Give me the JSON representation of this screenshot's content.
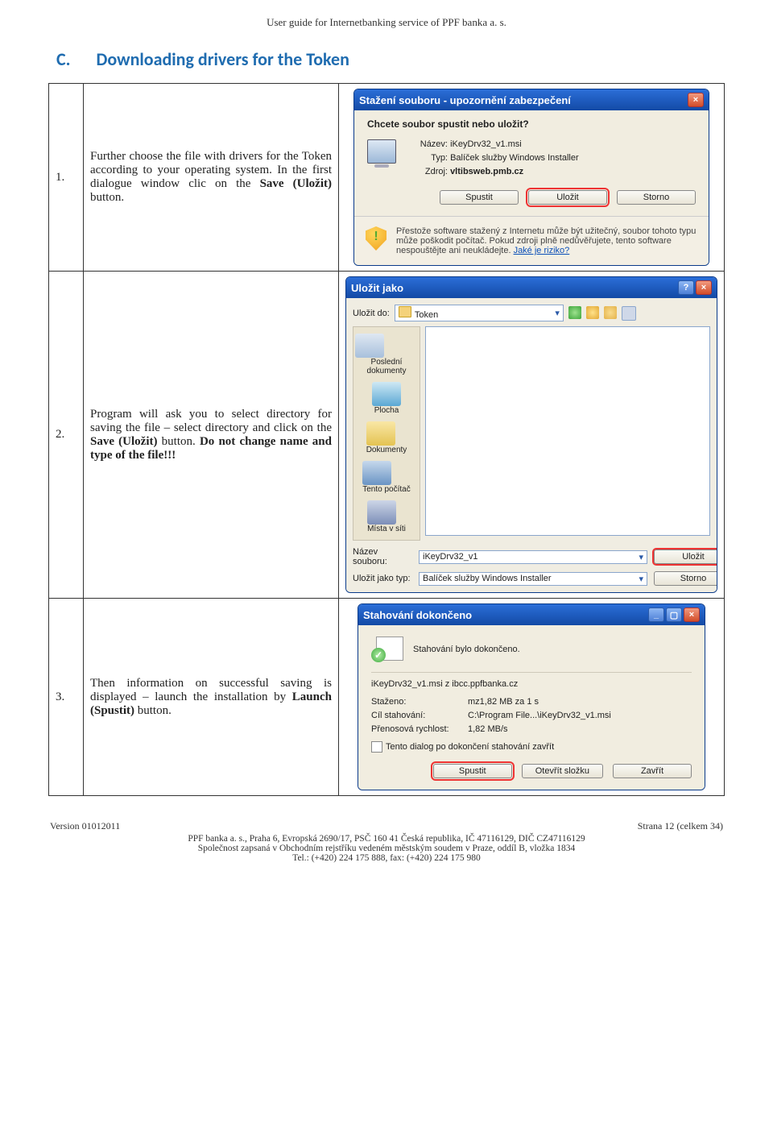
{
  "header": "User guide for Internetbanking service of PPF banka a. s.",
  "section": {
    "letter": "C.",
    "title": "Downloading drivers for the Token"
  },
  "rows": [
    {
      "num": "1.",
      "p1": "Further choose the file with drivers for the Token according to your operating system. In the first dialogue window clic on the ",
      "b1": "Save (Uložit)",
      "p2": " button."
    },
    {
      "num": "2.",
      "p1": "Program will ask you to select directory for saving the file – select directory and click on the ",
      "b1": "Save (Uložit)",
      "p2": " button.",
      "b2": " Do not change name and type of the file!!!"
    },
    {
      "num": "3.",
      "p1": "Then information on successful saving is displayed – launch the installation by ",
      "b1": "Launch (Spustit)",
      "p2": " button."
    }
  ],
  "dialog1": {
    "title": "Stažení souboru - upozornění zabezpečení",
    "subtitle": "Chcete soubor spustit nebo uložit?",
    "labels": {
      "name": "Název:",
      "type": "Typ:",
      "source": "Zdroj:"
    },
    "name": "iKeyDrv32_v1.msi",
    "type": "Balíček služby Windows Installer",
    "source": "vltibsweb.pmb.cz",
    "btnRun": "Spustit",
    "btnSave": "Uložit",
    "btnCancel": "Storno",
    "warning": "Přestože software stažený z Internetu může být užitečný, soubor tohoto typu může poškodit počítač. Pokud zdroji plně nedůvěřujete, tento software nespouštějte ani neukládejte. ",
    "warnLink": "Jaké je riziko?"
  },
  "dialog2": {
    "title": "Uložit jako",
    "saveIn": "Uložit do:",
    "folder": "Token",
    "places": {
      "recent": "Poslední dokumenty",
      "desktop": "Plocha",
      "docs": "Dokumenty",
      "pc": "Tento počítač",
      "net": "Místa v síti"
    },
    "labels": {
      "filename": "Název souboru:",
      "filetype": "Uložit jako typ:"
    },
    "filename": "iKeyDrv32_v1",
    "filetype": "Balíček služby Windows Installer",
    "btnSave": "Uložit",
    "btnCancel": "Storno"
  },
  "dialog3": {
    "title": "Stahování dokončeno",
    "done": "Stahování bylo dokončeno.",
    "file": "iKeyDrv32_v1.msi z ibcc.ppfbanka.cz",
    "labels": {
      "downloaded": "Staženo:",
      "target": "Cíl stahování:",
      "rate": "Přenosová rychlost:"
    },
    "downloaded": "mz1,82 MB za 1 s",
    "target": "C:\\Program File...\\iKeyDrv32_v1.msi",
    "rate": "1,82 MB/s",
    "checkbox": "Tento dialog po dokončení stahování zavřít",
    "btnRun": "Spustit",
    "btnOpen": "Otevřít složku",
    "btnClose": "Zavřít"
  },
  "footer": {
    "version": "Version 01012011",
    "page": "Strana 12 (celkem 34)",
    "line1": "PPF banka a. s., Praha 6, Evropská 2690/17, PSČ 160 41 Česká republika, IČ 47116129, DIČ CZ47116129",
    "line2": "Společnost zapsaná v Obchodním rejstříku vedeném městským soudem v Praze, oddíl B, vložka 1834",
    "line3": "Tel.: (+420) 224 175 888, fax: (+420) 224 175 980"
  }
}
